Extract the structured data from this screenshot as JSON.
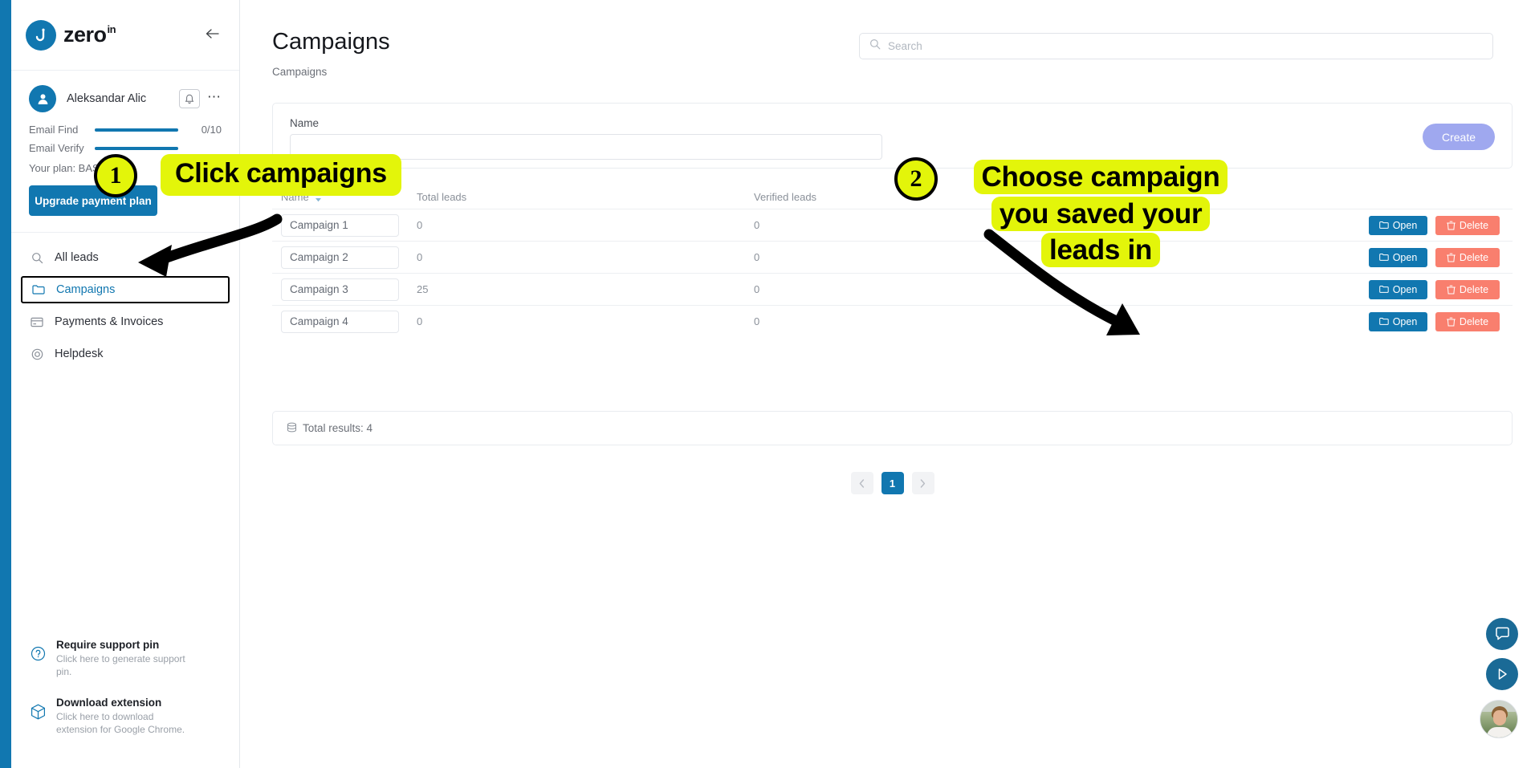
{
  "brand": {
    "name": "zero",
    "superscript": "in",
    "collapse_icon": "arrow-left-icon"
  },
  "sidebar": {
    "user": {
      "name": "Aleksandar Alic",
      "avatar_icon": "user-icon",
      "bell_icon": "bell-icon",
      "more_icon": "more-dots-icon"
    },
    "quotas": [
      {
        "label": "Email Find",
        "value": "0/10",
        "percent": 100
      },
      {
        "label": "Email Verify",
        "value": "",
        "percent": 100
      }
    ],
    "plan_line": "Your plan: BAS",
    "upgrade_label": "Upgrade payment plan",
    "nav": [
      {
        "label": "All leads",
        "icon": "search-icon",
        "active": false
      },
      {
        "label": "Campaigns",
        "icon": "folder-icon",
        "active": true
      },
      {
        "label": "Payments & Invoices",
        "icon": "credit-card-icon",
        "active": false
      },
      {
        "label": "Helpdesk",
        "icon": "lifebuoy-icon",
        "active": false
      }
    ],
    "footer": [
      {
        "icon": "question-circle-icon",
        "title": "Require support pin",
        "subtitle": "Click here to generate support pin."
      },
      {
        "icon": "box-icon",
        "title": "Download extension",
        "subtitle": "Click here to download extension for Google Chrome."
      }
    ]
  },
  "header": {
    "title": "Campaigns",
    "breadcrumb": "Campaigns",
    "search": {
      "placeholder": "Search",
      "value": "",
      "icon": "search-icon"
    }
  },
  "create_panel": {
    "name_label": "Name",
    "name_value": "",
    "name_placeholder": "",
    "create_label": "Create"
  },
  "table": {
    "columns": [
      "Name",
      "Total leads",
      "Verified leads"
    ],
    "sort_icon": "sort-updown-icon",
    "rows": [
      {
        "name": "Campaign 1",
        "total_leads": "0",
        "verified_leads": "0"
      },
      {
        "name": "Campaign 2",
        "total_leads": "0",
        "verified_leads": "0"
      },
      {
        "name": "Campaign 3",
        "total_leads": "25",
        "verified_leads": "0"
      },
      {
        "name": "Campaign 4",
        "total_leads": "0",
        "verified_leads": "0"
      }
    ],
    "open_label": "Open",
    "delete_label": "Delete",
    "open_icon": "folder-open-icon",
    "delete_icon": "trash-icon",
    "total_results": "Total results: 4",
    "total_results_icon": "database-icon"
  },
  "pagination": {
    "prev_icon": "chevron-left-icon",
    "next_icon": "chevron-right-icon",
    "pages": [
      "1"
    ],
    "current": "1"
  },
  "floating": [
    {
      "name": "chat",
      "icon": "chat-bubble-icon"
    },
    {
      "name": "play",
      "icon": "play-icon"
    },
    {
      "name": "avatar",
      "icon": "person-photo-icon"
    }
  ],
  "annotations": {
    "step1": {
      "number": "1",
      "text": "Click campaigns"
    },
    "step2": {
      "number": "2",
      "line1": "Choose campaign",
      "line2": "you saved your",
      "line3": "leads in"
    }
  },
  "colors": {
    "brand_blue": "#1177b0",
    "highlight_yellow": "#e3f50a",
    "delete_red": "#f97f6e",
    "create_purple": "#9fa8ef"
  }
}
